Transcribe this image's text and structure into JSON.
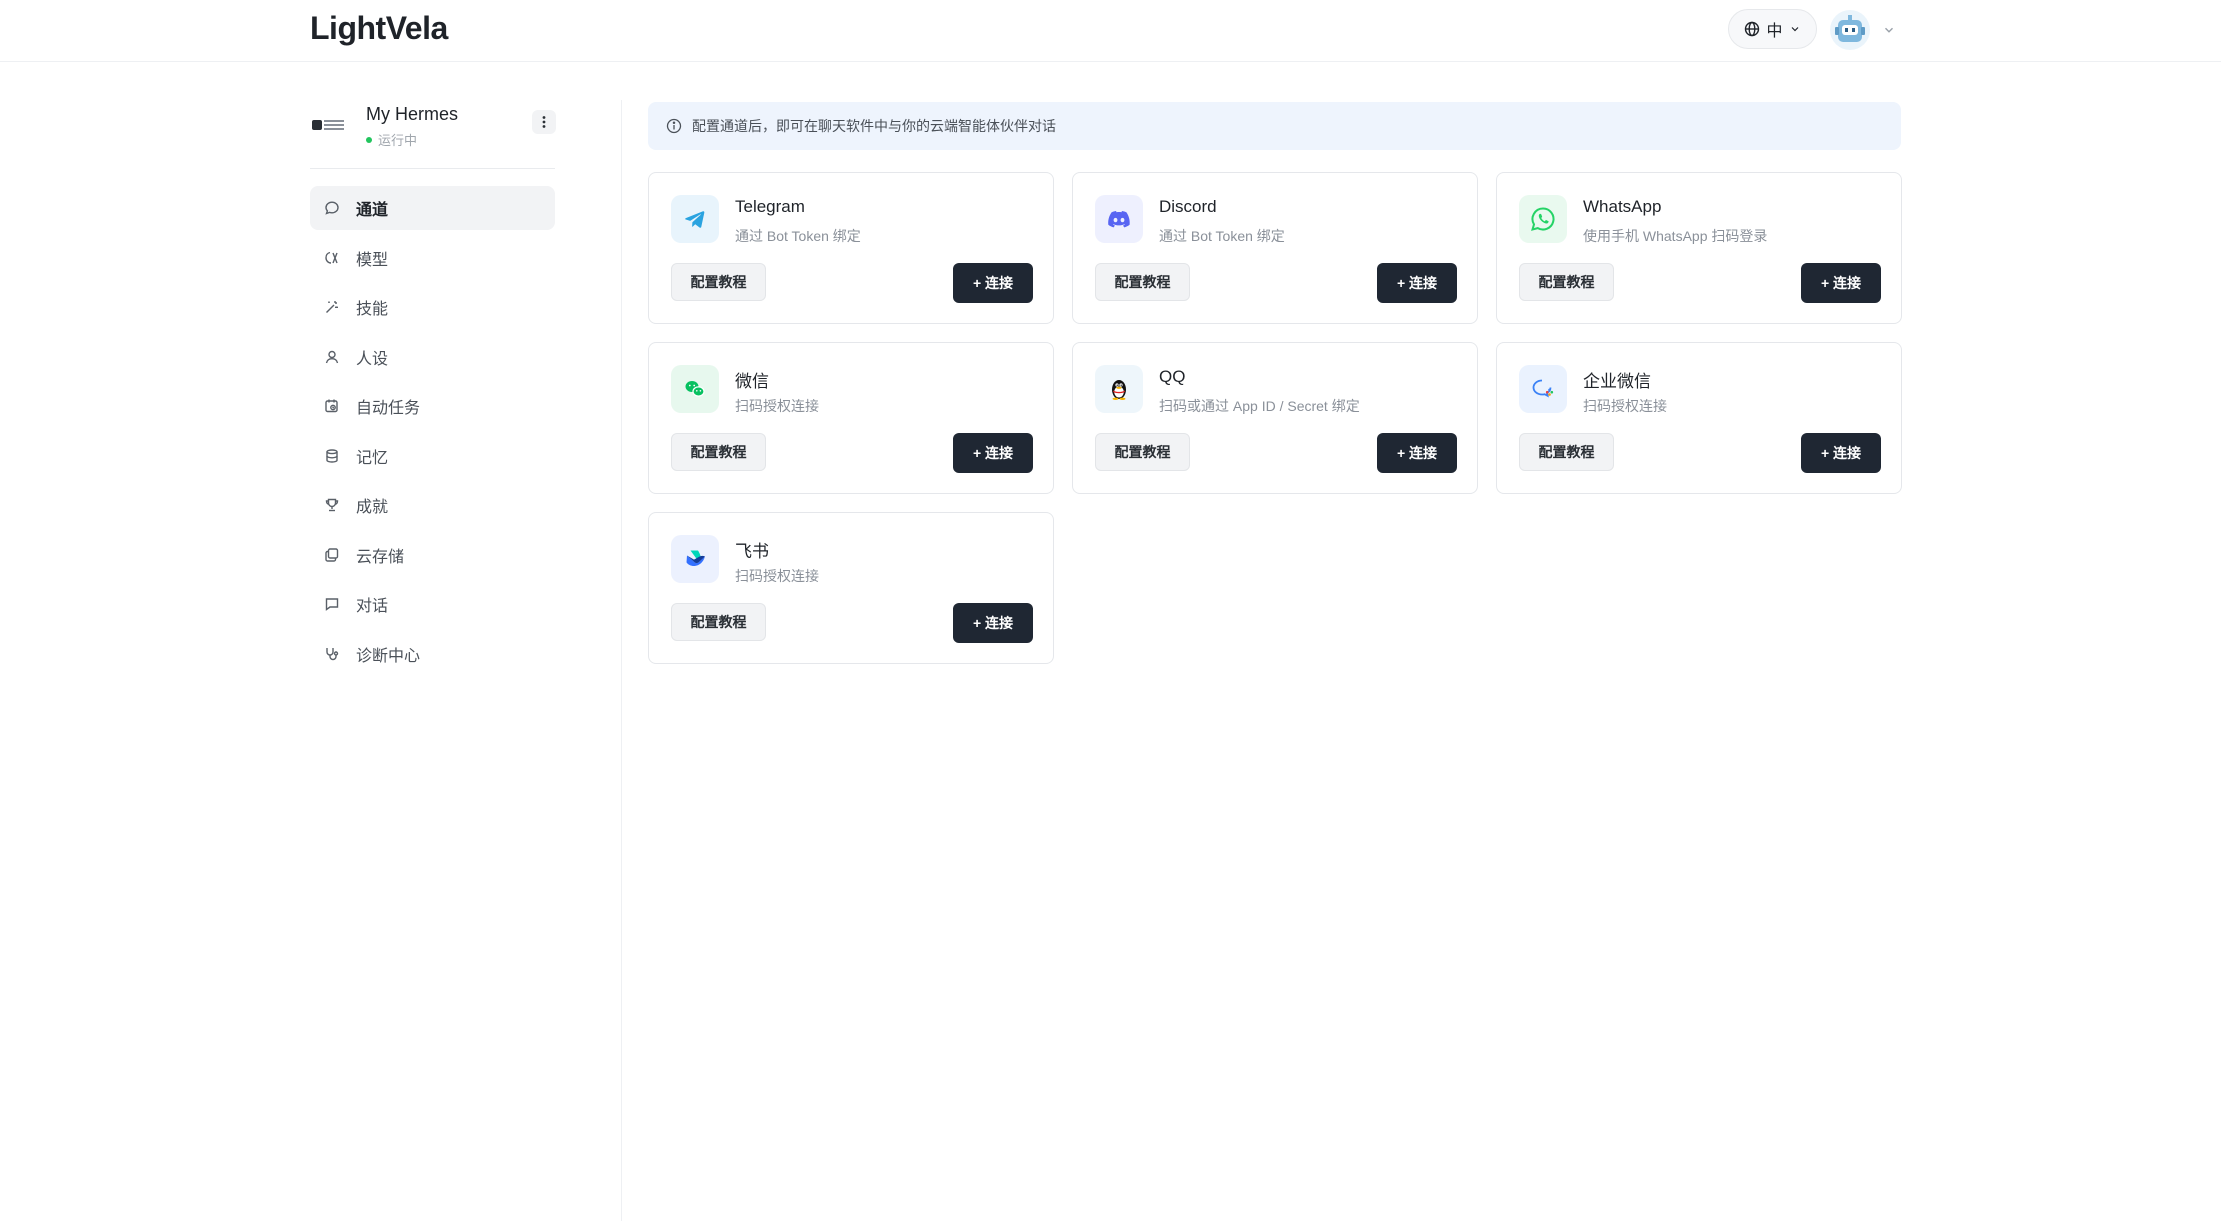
{
  "header": {
    "brand": "LightVela",
    "language_label": "中",
    "globe_icon": "globe-icon",
    "chevron_icon": "chevron-down-icon",
    "avatar_icon": "robot-avatar-icon"
  },
  "agent": {
    "name": "My Hermes",
    "status": "运行中",
    "status_color": "#22c55e",
    "menu_icon": "more-vertical-icon"
  },
  "sidebar": {
    "items": [
      {
        "label": "通道",
        "icon": "chat-bubble-icon",
        "active": true
      },
      {
        "label": "模型",
        "icon": "model-icon",
        "active": false
      },
      {
        "label": "技能",
        "icon": "magic-wand-icon",
        "active": false
      },
      {
        "label": "人设",
        "icon": "user-icon",
        "active": false
      },
      {
        "label": "自动任务",
        "icon": "calendar-clock-icon",
        "active": false
      },
      {
        "label": "记忆",
        "icon": "database-icon",
        "active": false
      },
      {
        "label": "成就",
        "icon": "trophy-icon",
        "active": false
      },
      {
        "label": "云存储",
        "icon": "cloud-storage-icon",
        "active": false
      },
      {
        "label": "对话",
        "icon": "message-square-icon",
        "active": false
      },
      {
        "label": "诊断中心",
        "icon": "stethoscope-icon",
        "active": false
      }
    ]
  },
  "main": {
    "info_text": "配置通道后，即可在聊天软件中与你的云端智能体伙伴对话",
    "info_icon": "info-circle-icon",
    "guide_label": "配置教程",
    "connect_label": "+ 连接",
    "channels": [
      {
        "name": "Telegram",
        "desc": "通过 Bot Token 绑定",
        "icon": "telegram-icon",
        "color": "#2aa3e0"
      },
      {
        "name": "Discord",
        "desc": "通过 Bot Token 绑定",
        "icon": "discord-icon",
        "color": "#5865f2"
      },
      {
        "name": "WhatsApp",
        "desc": "使用手机 WhatsApp 扫码登录",
        "icon": "whatsapp-icon",
        "color": "#25d366"
      },
      {
        "name": "微信",
        "desc": "扫码授权连接",
        "icon": "wechat-icon",
        "color": "#07c160"
      },
      {
        "name": "QQ",
        "desc": "扫码或通过 App ID / Secret 绑定",
        "icon": "qq-penguin-icon",
        "color": "#12b7f5"
      },
      {
        "name": "企业微信",
        "desc": "扫码授权连接",
        "icon": "wecom-icon",
        "color": "#3b82f6"
      },
      {
        "name": "飞书",
        "desc": "扫码授权连接",
        "icon": "feishu-icon",
        "color": "#3370ff"
      }
    ]
  },
  "colors": {
    "accent_dark": "#1f2733",
    "info_bg": "#eef4fd",
    "active_nav_bg": "#f2f3f5"
  }
}
